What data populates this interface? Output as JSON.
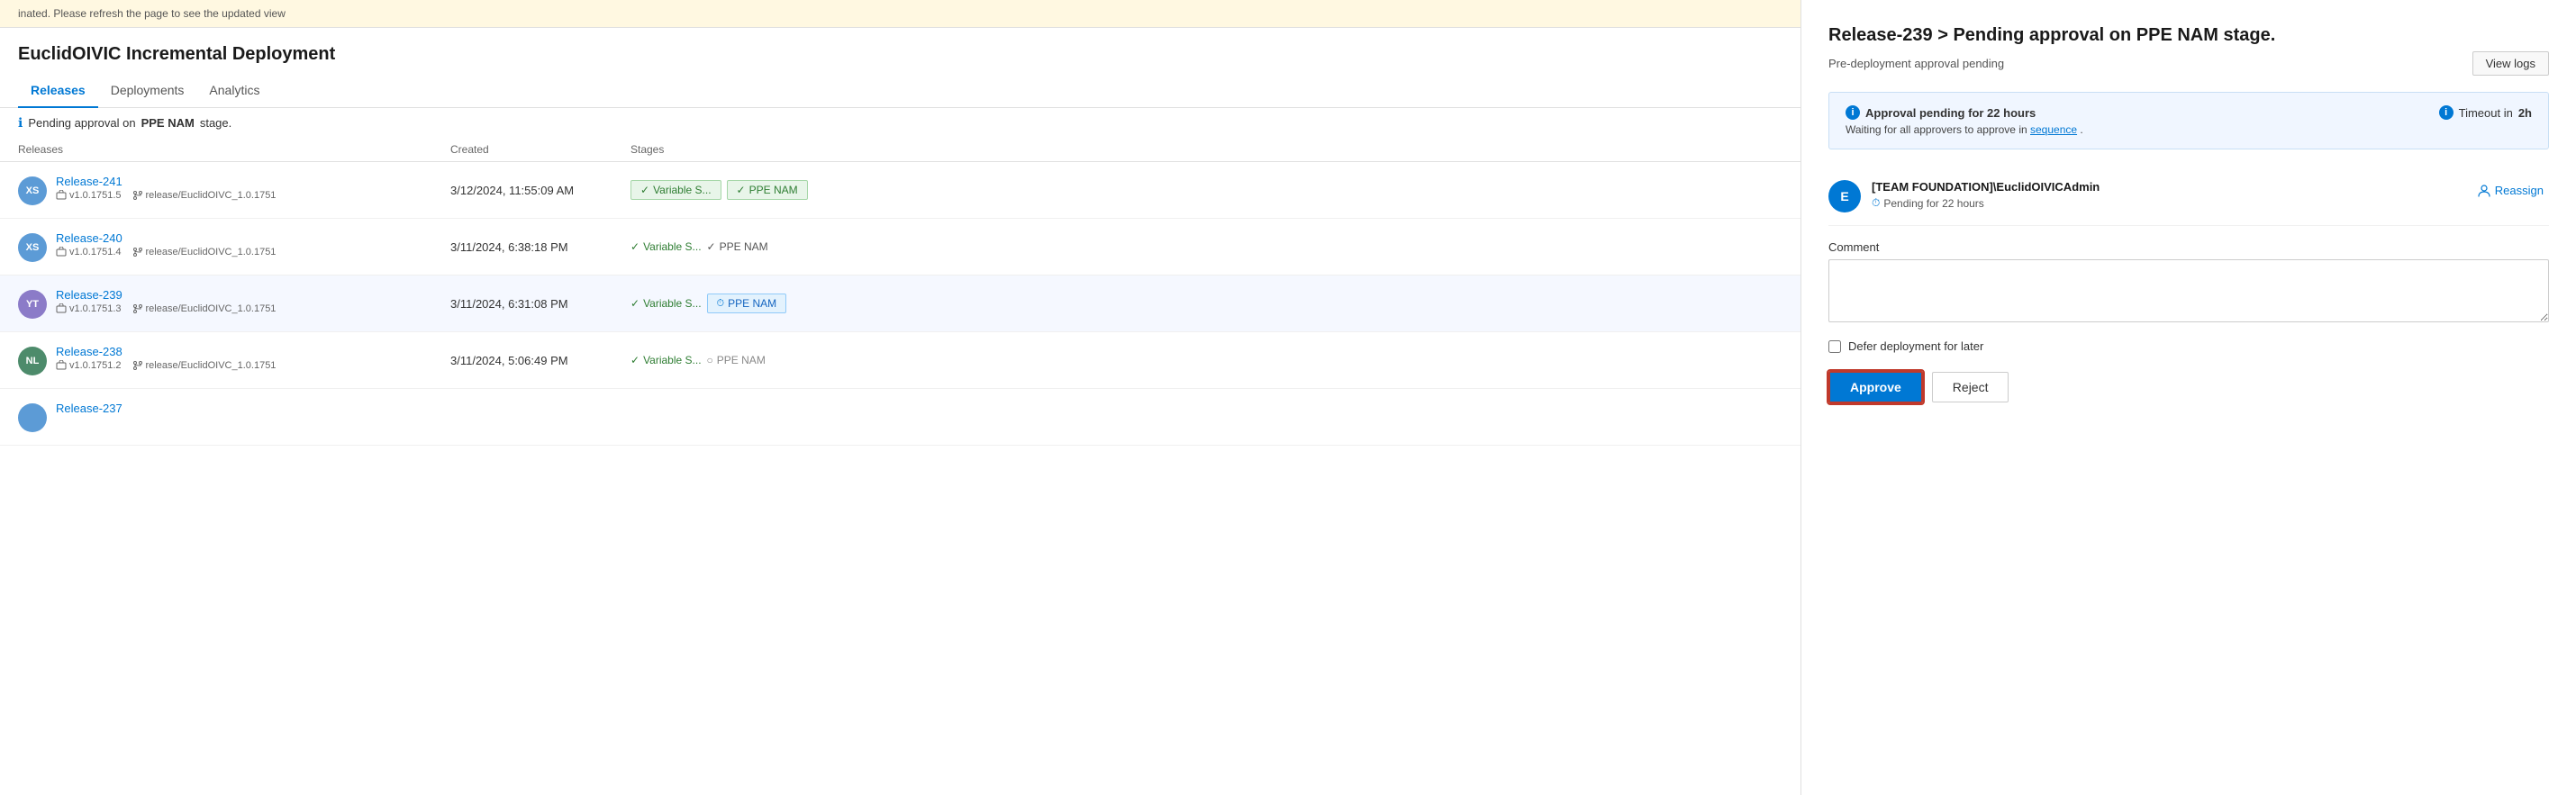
{
  "banner": {
    "text": "inated. Please refresh the page to see the updated view"
  },
  "left": {
    "title": "EuclidOIVIC Incremental Deployment",
    "tabs": [
      {
        "id": "releases",
        "label": "Releases",
        "active": true
      },
      {
        "id": "deployments",
        "label": "Deployments",
        "active": false
      },
      {
        "id": "analytics",
        "label": "Analytics",
        "active": false
      }
    ],
    "status_message_prefix": "Pending approval on ",
    "status_message_bold": "PPE NAM",
    "status_message_suffix": " stage.",
    "table": {
      "columns": [
        "Releases",
        "Created",
        "Stages"
      ],
      "rows": [
        {
          "id": "release-241",
          "avatar_initials": "XS",
          "avatar_class": "xs",
          "name": "Release-241",
          "version": "v1.0.1751.5",
          "branch": "release/EuclidOIVC_1.0.1751",
          "created": "3/12/2024, 11:55:09 AM",
          "stages": [
            {
              "label": "Variable S...",
              "type": "green"
            },
            {
              "label": "PPE NAM",
              "type": "green"
            }
          ]
        },
        {
          "id": "release-240",
          "avatar_initials": "XS",
          "avatar_class": "xs2",
          "name": "Release-240",
          "version": "v1.0.1751.4",
          "branch": "release/EuclidOIVC_1.0.1751",
          "created": "3/11/2024, 6:38:18 PM",
          "stages": [
            {
              "label": "Variable S...",
              "type": "green-text-only"
            },
            {
              "label": "PPE NAM",
              "type": "gray-text-only"
            }
          ]
        },
        {
          "id": "release-239",
          "avatar_initials": "YT",
          "avatar_class": "yt",
          "name": "Release-239",
          "version": "v1.0.1751.3",
          "branch": "release/EuclidOIVC_1.0.1751",
          "created": "3/11/2024, 6:31:08 PM",
          "stages": [
            {
              "label": "Variable S...",
              "type": "green-text-only"
            },
            {
              "label": "PPE NAM",
              "type": "pending-blue"
            }
          ]
        },
        {
          "id": "release-238",
          "avatar_initials": "NL",
          "avatar_class": "nl",
          "name": "Release-238",
          "version": "v1.0.1751.2",
          "branch": "release/EuclidOIVC_1.0.1751",
          "created": "3/11/2024, 5:06:49 PM",
          "stages": [
            {
              "label": "Variable S...",
              "type": "green-text-only"
            },
            {
              "label": "PPE NAM",
              "type": "gray-circle"
            }
          ]
        },
        {
          "id": "release-237",
          "avatar_initials": "...",
          "avatar_class": "xs",
          "name": "Release-237",
          "version": "",
          "branch": "",
          "created": "",
          "stages": []
        }
      ]
    }
  },
  "right": {
    "title": "Release-239 > Pending approval on PPE NAM stage.",
    "subtitle": "Pre-deployment approval pending",
    "view_logs_label": "View logs",
    "info_box": {
      "primary": "Approval pending for 22 hours",
      "secondary_prefix": "Waiting for all approvers to approve in ",
      "secondary_link": "sequence",
      "secondary_suffix": ".",
      "timeout_label": "Timeout in ",
      "timeout_value": "2h"
    },
    "approver": {
      "avatar_initials": "E",
      "name": "[TEAM FOUNDATION]\\EuclidOIVICAdmin",
      "status": "Pending for 22 hours",
      "reassign_label": "Reassign"
    },
    "comment": {
      "label": "Comment",
      "placeholder": ""
    },
    "defer": {
      "label": "Defer deployment for later"
    },
    "approve_label": "Approve",
    "reject_label": "Reject"
  }
}
